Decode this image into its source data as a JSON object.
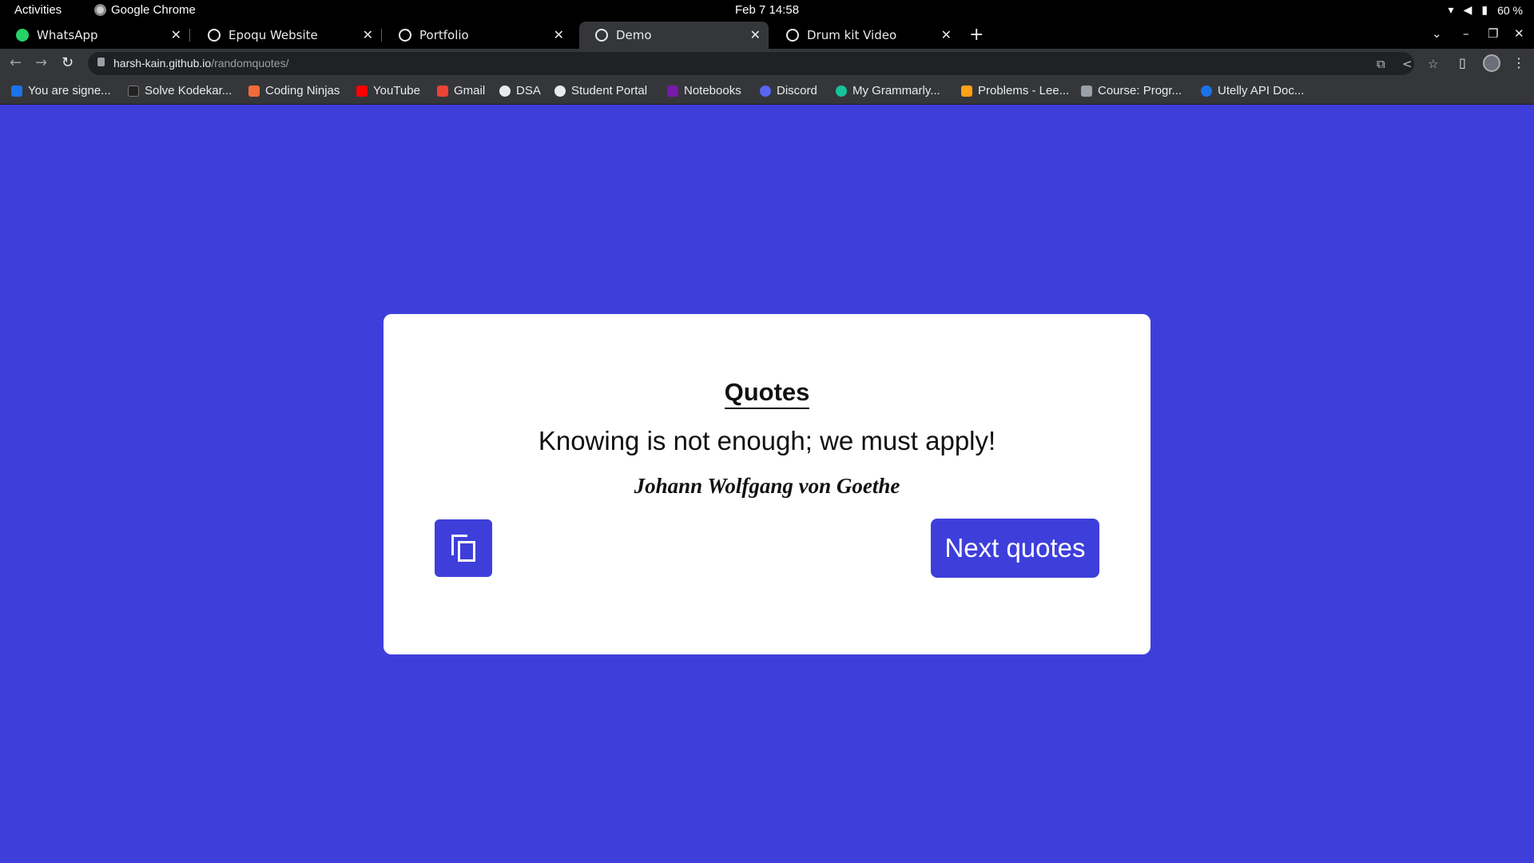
{
  "system_bar": {
    "activities": "Activities",
    "app_name": "Google Chrome",
    "datetime": "Feb 7  14:58",
    "battery": "60 %"
  },
  "tabs": [
    {
      "title": "WhatsApp",
      "icon": "whatsapp-icon"
    },
    {
      "title": "Epoqu Website",
      "icon": "globe-icon"
    },
    {
      "title": "Portfolio",
      "icon": "globe-icon"
    },
    {
      "title": "Demo",
      "icon": "globe-icon",
      "active": true
    },
    {
      "title": "Drum kit Video",
      "icon": "globe-icon"
    }
  ],
  "address_bar": {
    "host": "harsh-kain.github.io",
    "path": "/randomquotes/"
  },
  "bookmarks": [
    {
      "label": "You are signe...",
      "color": "#1a73e8"
    },
    {
      "label": "Solve Kodekar...",
      "color": "#222222"
    },
    {
      "label": "Coding Ninjas",
      "color": "#f26b3a"
    },
    {
      "label": "YouTube",
      "color": "#ff0000"
    },
    {
      "label": "Gmail",
      "color": "#ea4335"
    },
    {
      "label": "DSA",
      "color": "#e8eaed"
    },
    {
      "label": "Student Portal",
      "color": "#e8eaed"
    },
    {
      "label": "Notebooks",
      "color": "#7719aa"
    },
    {
      "label": "Discord",
      "color": "#5865f2"
    },
    {
      "label": "My Grammarly...",
      "color": "#15c39a"
    },
    {
      "label": "Problems - Lee...",
      "color": "#ffa116"
    },
    {
      "label": "Course: Progr...",
      "color": "#9aa0a6"
    },
    {
      "label": "Utelly API Doc...",
      "color": "#1a73e8"
    }
  ],
  "page": {
    "title": "Quotes",
    "quote": "Knowing is not enough; we must apply!",
    "author": "Johann Wolfgang von Goethe",
    "next_button": "Next quotes",
    "background_color": "#3e3fdb"
  }
}
